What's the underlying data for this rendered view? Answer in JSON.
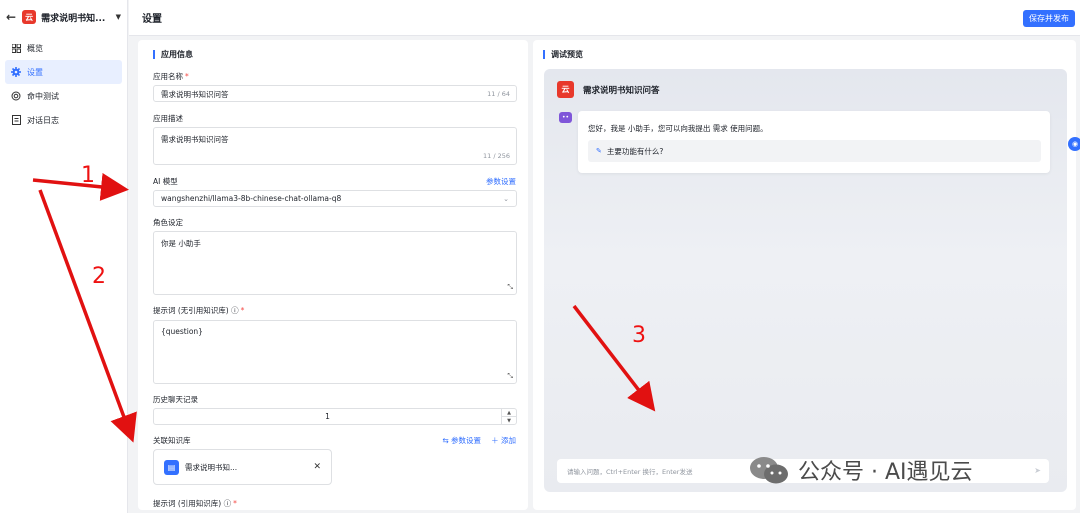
{
  "sidebar": {
    "app_logo": "云",
    "app_name": "需求说明书知...",
    "items": [
      {
        "label": "概览",
        "icon": "grid-icon"
      },
      {
        "label": "设置",
        "icon": "gear-icon"
      },
      {
        "label": "命中测试",
        "icon": "target-icon"
      },
      {
        "label": "对话日志",
        "icon": "document-icon"
      }
    ]
  },
  "header": {
    "title": "设置",
    "publish_label": "保存并发布"
  },
  "settings": {
    "section_title": "应用信息",
    "name_label": "应用名称",
    "name_value": "需求说明书知识问答",
    "name_counter": "11 / 64",
    "desc_label": "应用描述",
    "desc_value": "需求说明书知识问答",
    "desc_counter": "11 / 256",
    "model_label": "AI 模型",
    "model_params_link": "参数设置",
    "model_value": "wangshenzhi/llama3-8b-chinese-chat-ollama-q8",
    "role_label": "角色设定",
    "role_value": "你是 小助手",
    "prompt_label": "提示词 (无引用知识库)",
    "prompt_value": "{question}",
    "history_label": "历史聊天记录",
    "history_value": "1",
    "kb_label": "关联知识库",
    "kb_params_link": "参数设置",
    "kb_add_link": "添加",
    "kb_item_name": "需求说明书知...",
    "prompt2_label": "提示词 (引用知识库)"
  },
  "preview": {
    "section_title": "调试预览",
    "chat_title": "需求说明书知识问答",
    "chat_logo": "云",
    "greeting": "您好，我是 小助手，您可以向我提出 需求 使用问题。",
    "suggestion": "主要功能有什么?",
    "input_placeholder": "请输入问题，Ctrl+Enter 换行，Enter发送"
  },
  "annotations": {
    "n1": "1",
    "n2": "2",
    "n3": "3",
    "watermark": "公众号 · AI遇见云"
  },
  "colors": {
    "accent": "#3370ff",
    "brand": "#e8382b",
    "annotation": "#e11111"
  }
}
